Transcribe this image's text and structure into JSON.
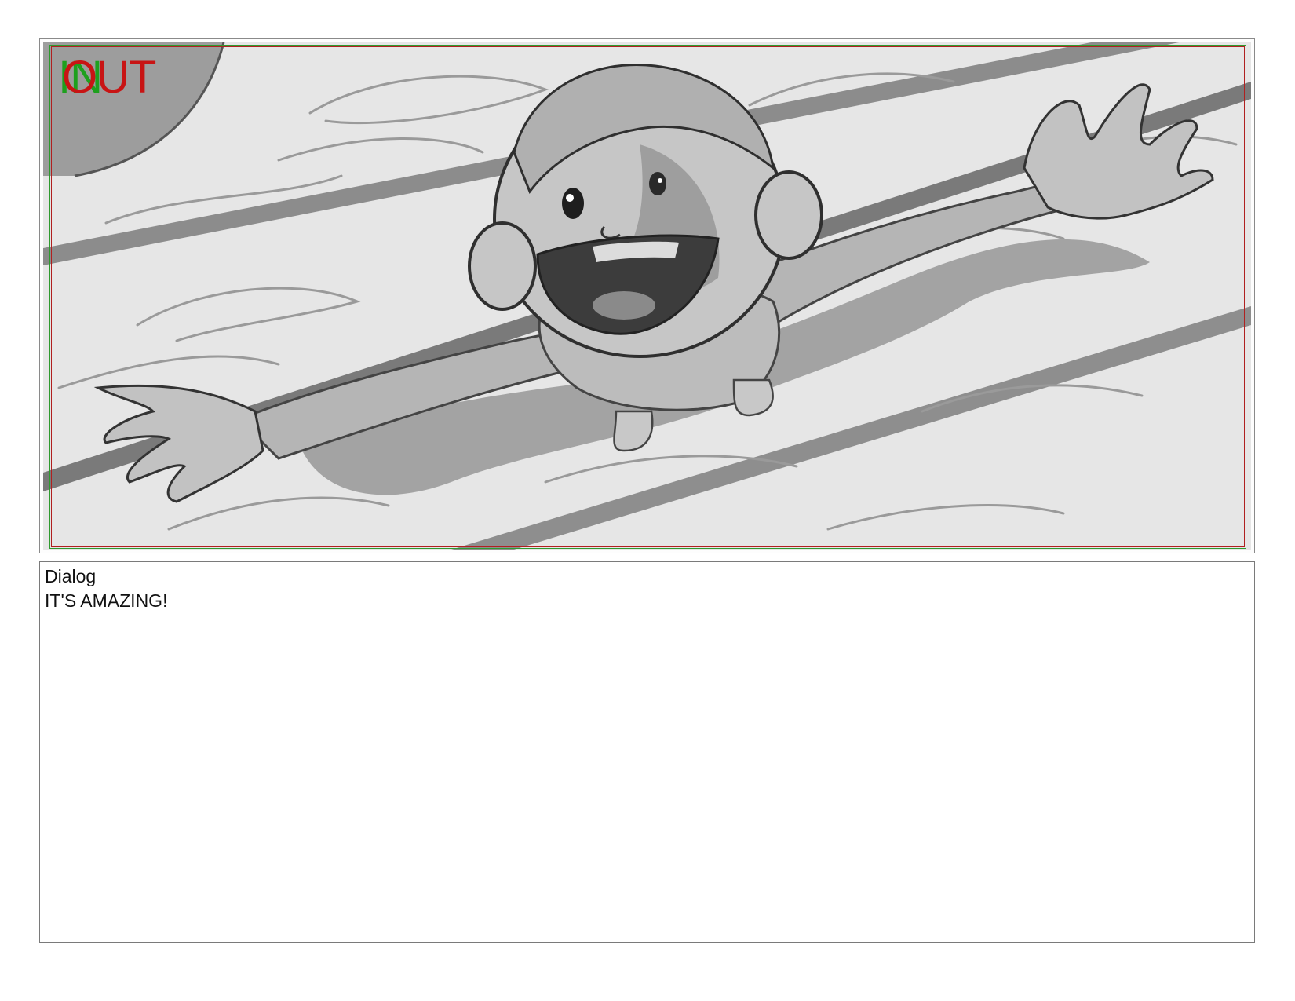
{
  "panel": {
    "in_marker": "IN",
    "out_marker": "OUT",
    "in_marker_color": "#1ea01e",
    "out_marker_color": "#c81414",
    "illustration": "storyboard-sketch-kid-arms-outstretched-on-wooden-floor"
  },
  "dialog": {
    "label": "Dialog",
    "text": "IT'S AMAZING!"
  }
}
